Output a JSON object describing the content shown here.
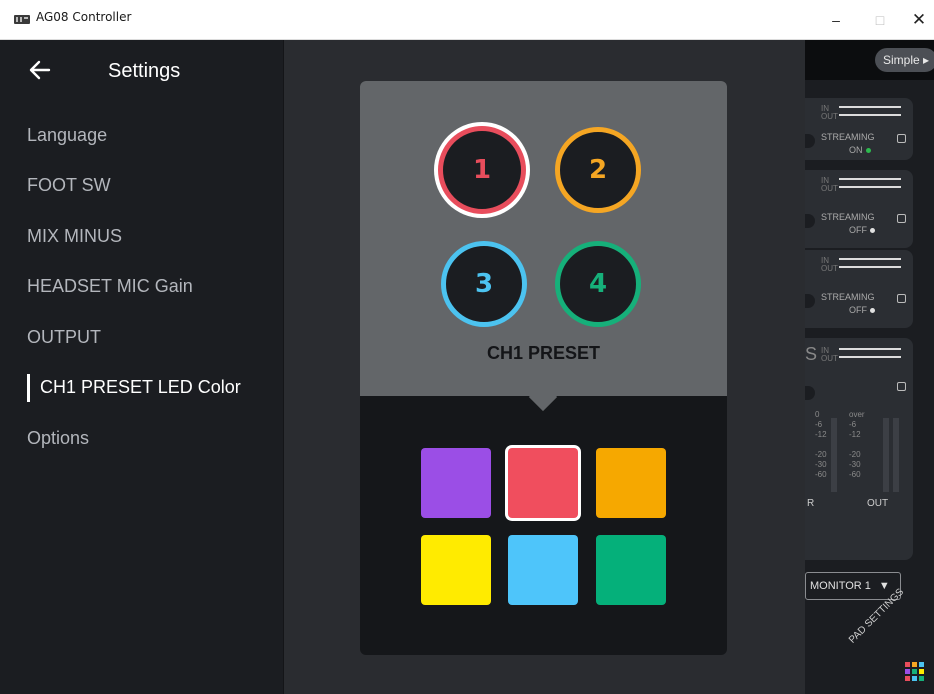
{
  "window": {
    "title": "AG08 Controller",
    "minimize": "–",
    "maximize": "□",
    "close": "✕"
  },
  "settings": {
    "title": "Settings",
    "menu": [
      {
        "label": "Language"
      },
      {
        "label": "FOOT SW"
      },
      {
        "label": "MIX MINUS"
      },
      {
        "label": "HEADSET MIC Gain"
      },
      {
        "label": "OUTPUT"
      },
      {
        "label": "CH1 PRESET LED Color",
        "active": true
      },
      {
        "label": "Options"
      }
    ]
  },
  "popup": {
    "presets": [
      {
        "number": "1",
        "color": "#e84d5c",
        "selected": true
      },
      {
        "number": "2",
        "color": "#f5a623"
      },
      {
        "number": "3",
        "color": "#4cc3f0"
      },
      {
        "number": "4",
        "color": "#16b07a"
      }
    ],
    "preset_label": "CH1 PRESET",
    "swatches": [
      {
        "name": "purple",
        "color": "#9b4ee6"
      },
      {
        "name": "red",
        "color": "#f04e5e",
        "selected": true
      },
      {
        "name": "orange",
        "color": "#f6a800"
      },
      {
        "name": "yellow",
        "color": "#ffeb00"
      },
      {
        "name": "light-blue",
        "color": "#4ec5fa"
      },
      {
        "name": "green",
        "color": "#05b07a"
      }
    ]
  },
  "background": {
    "mode_button": "Simple ▸",
    "strips": [
      {
        "in": "IN",
        "out": "OUT",
        "streaming": "STREAMING",
        "state": "ON",
        "state_color": "#2dbb4e"
      },
      {
        "in": "IN",
        "out": "OUT",
        "streaming": "STREAMING",
        "state": "OFF",
        "state_color": "#e0e0e0"
      },
      {
        "in": "IN",
        "out": "OUT",
        "streaming": "STREAMING",
        "state": "OFF",
        "state_color": "#e0e0e0"
      }
    ],
    "mix_strip": {
      "partial_label": "S",
      "in": "IN",
      "out": "OUT",
      "scale_left": [
        "0",
        "-6",
        "-12",
        "",
        "-20",
        "-30",
        "-60"
      ],
      "scale_over": "over",
      "scale_right": [
        "-6",
        "-12",
        "",
        "-20",
        "-30",
        "-60"
      ],
      "left_label": "R",
      "right_label": "OUT"
    },
    "monitor_select": "MONITOR 1",
    "pad_settings": "PAD SETTINGS",
    "pad_colors": [
      "#e84d5c",
      "#f5a623",
      "#4cc3f0",
      "#9b4ee6",
      "#16b07a",
      "#ffeb00",
      "#e84d5c",
      "#4cc3f0",
      "#16b07a"
    ]
  }
}
